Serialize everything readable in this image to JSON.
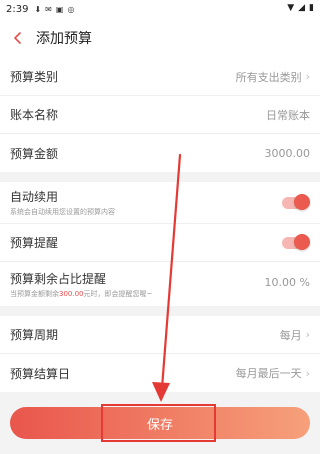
{
  "status_bar": {
    "time": "2:39"
  },
  "header": {
    "title": "添加预算"
  },
  "group1": {
    "budget_type": {
      "label": "预算类别",
      "value": "所有支出类别"
    },
    "account_name": {
      "label": "账本名称",
      "value": "日常账本"
    },
    "budget_amount": {
      "label": "预算金额",
      "value": "3000.00"
    }
  },
  "group2": {
    "auto_renew": {
      "label": "自动续用",
      "sub": "系统会自动续用您设置的预算内容",
      "enabled": true
    },
    "budget_reminder": {
      "label": "预算提醒",
      "enabled": true
    },
    "remaining_ratio": {
      "label": "预算剩余占比提醒",
      "sub_prefix": "当预算金额剩余",
      "sub_amount": "300.00",
      "sub_suffix": "元时，即会提醒您喔~",
      "value": "10.00 %"
    }
  },
  "group3": {
    "budget_period": {
      "label": "预算周期",
      "value": "每月"
    },
    "settlement_day": {
      "label": "预算结算日",
      "value": "每月最后一天"
    }
  },
  "save_button": {
    "label": "保存"
  },
  "colors": {
    "accent": "#ea5a4e",
    "annotation": "#e53935"
  }
}
